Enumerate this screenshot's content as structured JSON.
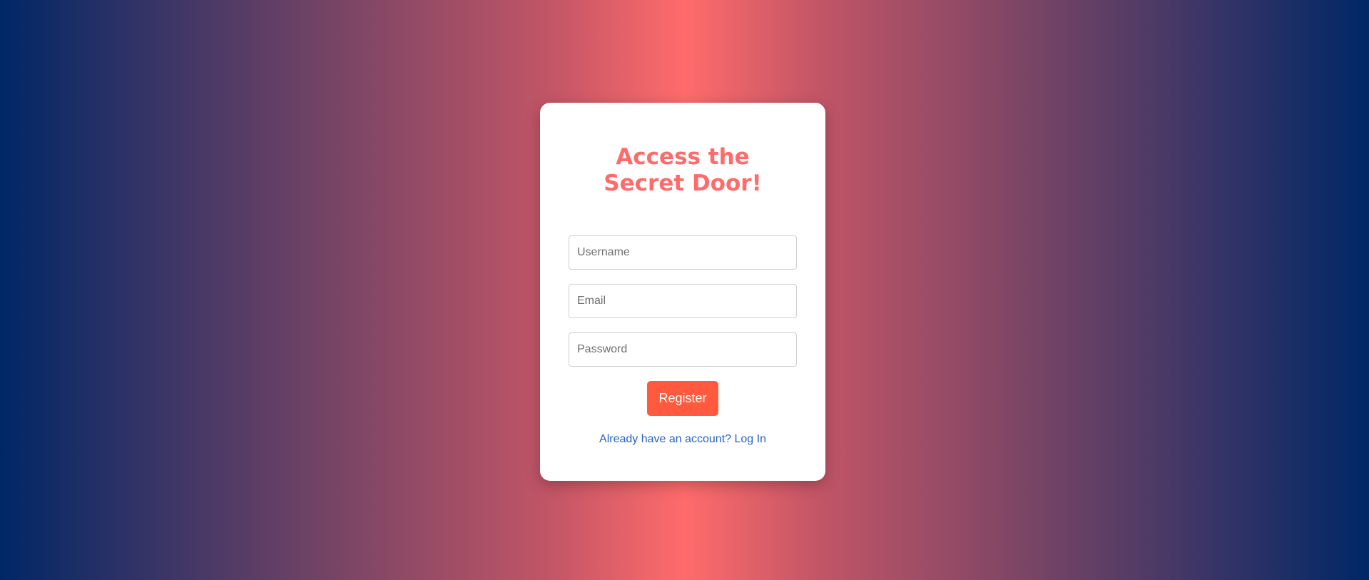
{
  "card": {
    "title": "Access the Secret Door!"
  },
  "form": {
    "username_placeholder": "Username",
    "username_value": "",
    "email_placeholder": "Email",
    "email_value": "",
    "password_placeholder": "Password",
    "password_value": "",
    "register_label": "Register",
    "login_link": "Already have an account? Log In"
  },
  "colors": {
    "title": "#ff6b6b",
    "button": "#ff5a3d",
    "link": "#2563c9",
    "gradient_edge": "#002766",
    "gradient_center": "#ff6b6b"
  }
}
